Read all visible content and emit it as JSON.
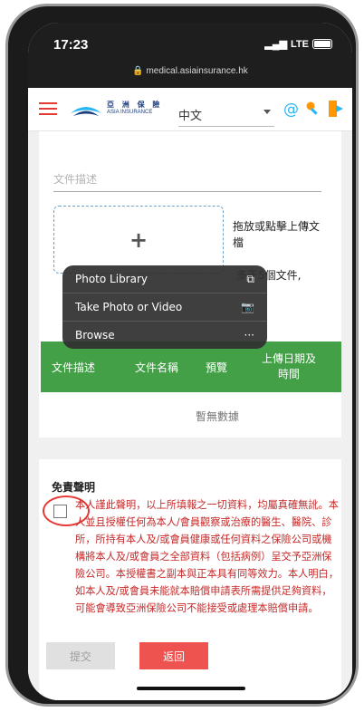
{
  "status_bar": {
    "time": "17:23",
    "network": "LTE",
    "url": "medical.asiainsurance.hk"
  },
  "header": {
    "logo_zh": "亞 洲 保 險",
    "logo_en": "ASIA INSURANCE",
    "language": "中文",
    "icons": [
      "menu-icon",
      "at-icon",
      "key-icon",
      "exit-icon"
    ]
  },
  "upload": {
    "description_placeholder": "文件描述",
    "drop_hint": "拖放或點擊上傳文檔",
    "limit_hint": "多于5個文件,",
    "plus": "+"
  },
  "action_sheet": {
    "items": [
      {
        "label": "Photo Library",
        "icon": "⧉"
      },
      {
        "label": "Take Photo or Video",
        "icon": "📷"
      },
      {
        "label": "Browse",
        "icon": "···"
      }
    ]
  },
  "table": {
    "headers": [
      "文件描述",
      "文件名稱",
      "預覽",
      "上傳日期及時間"
    ],
    "empty_text": "暫無數據"
  },
  "disclaimer": {
    "title": "免責聲明",
    "text": "本人謹此聲明，以上所填報之一切資料，均屬真確無訛。本人並且授權任何為本人/會員觀察或治療的醫生、醫院、診所，所持有本人及/或會員健康或任何資料之保險公司或機構將本人及/或會員之全部資料（包括病例）呈交予亞洲保險公司。本授權書之副本與正本具有同等效力。本人明白，如本人及/或會員未能就本賠償申請表所需提供足夠資料，可能會導致亞洲保險公司不能接受或處理本賠償申請。"
  },
  "buttons": {
    "submit": "提交",
    "back": "返回"
  },
  "colors": {
    "brand_red": "#e53935",
    "table_green": "#43a047",
    "disclaimer_red": "#c62828",
    "logo_blue": "#1a3c7c"
  }
}
